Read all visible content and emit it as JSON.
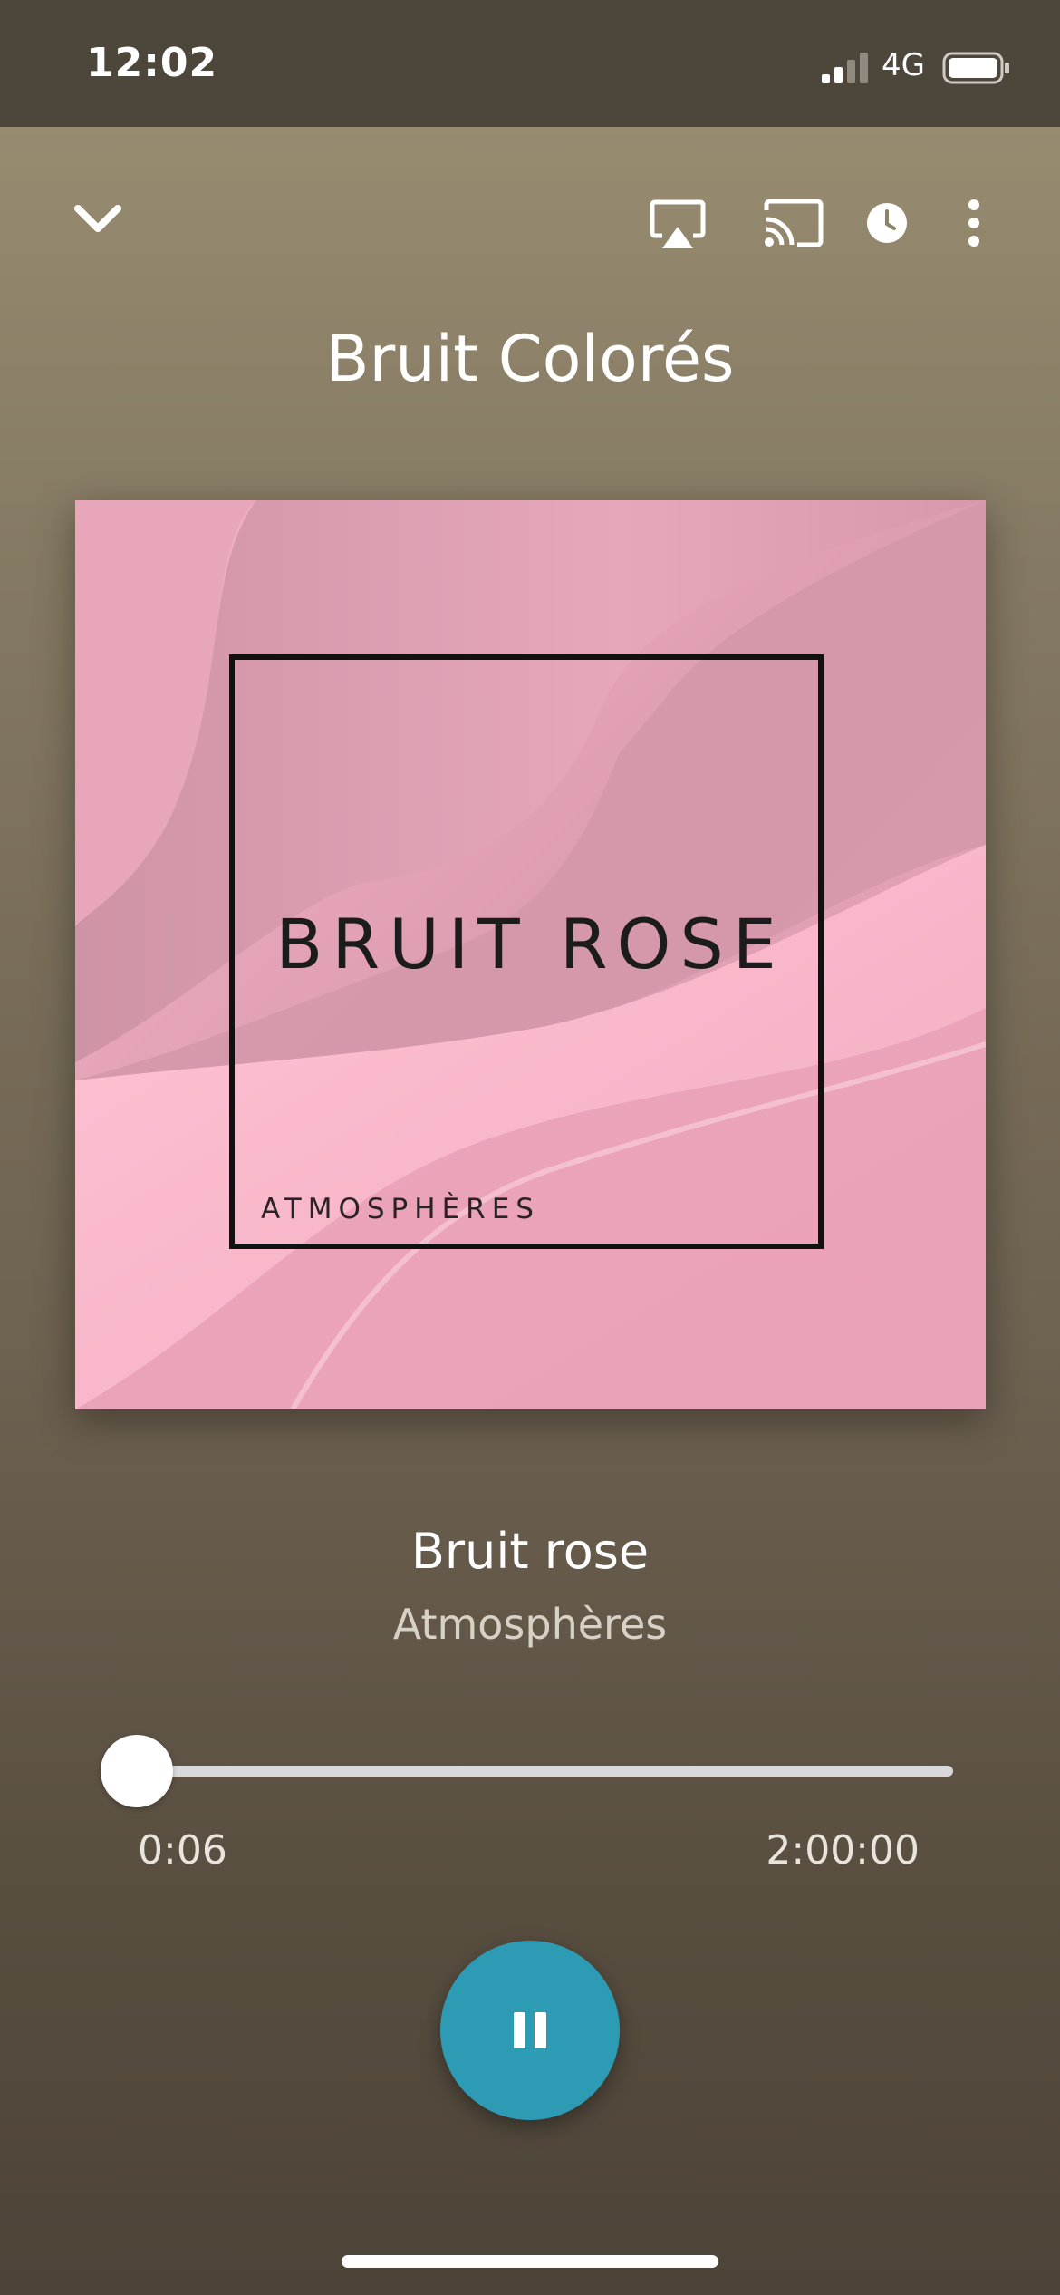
{
  "status_bar": {
    "time": "12:02",
    "network": "4G",
    "signal_icon": "cellular-signal-icon",
    "battery_icon": "battery-icon"
  },
  "toolbar": {
    "collapse_icon": "chevron-down-icon",
    "airplay_icon": "airplay-icon",
    "cast_icon": "cast-icon",
    "timer_icon": "clock-icon",
    "menu_icon": "more-vertical-icon"
  },
  "player": {
    "title": "Bruit Colorés"
  },
  "artwork": {
    "title": "BRUIT ROSE",
    "subtitle": "ATMOSPHÈRES",
    "colors": {
      "base": "#e9a7bb",
      "light": "#f7b9cb",
      "shadow": "#c68d9f"
    }
  },
  "track": {
    "title": "Bruit rose",
    "artist": "Atmosphères"
  },
  "progress": {
    "elapsed": "0:06",
    "total": "2:00:00",
    "fraction": 0.0008
  },
  "controls": {
    "play_pause_icon": "pause-icon",
    "accent_color": "#2e9bb5"
  }
}
